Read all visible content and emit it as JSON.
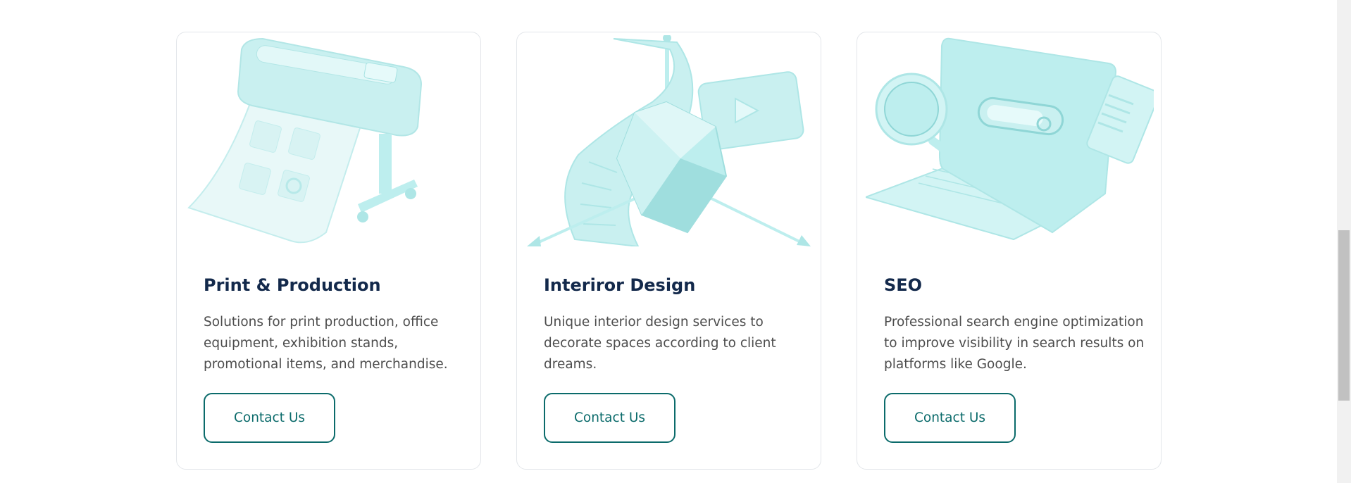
{
  "services": [
    {
      "title": "Print & Production",
      "description": "Solutions for print production, office equipment, exhibition stands, promotional items, and merchandise.",
      "button_label": "Contact Us",
      "illustration": "printer-illustration"
    },
    {
      "title": "Interiror Design",
      "description": "Unique interior design services to decorate spaces according to client dreams.",
      "button_label": "Contact Us",
      "illustration": "design-illustration"
    },
    {
      "title": "SEO",
      "description": "Professional search engine optimization to improve visibility in search results on platforms like Google.",
      "button_label": "Contact Us",
      "illustration": "laptop-search-illustration"
    }
  ],
  "colors": {
    "title": "#13294b",
    "body_text": "#4d4d4d",
    "accent": "#0b6b6b",
    "illustration": "#aee6e6",
    "card_border": "#e3e6ea"
  }
}
